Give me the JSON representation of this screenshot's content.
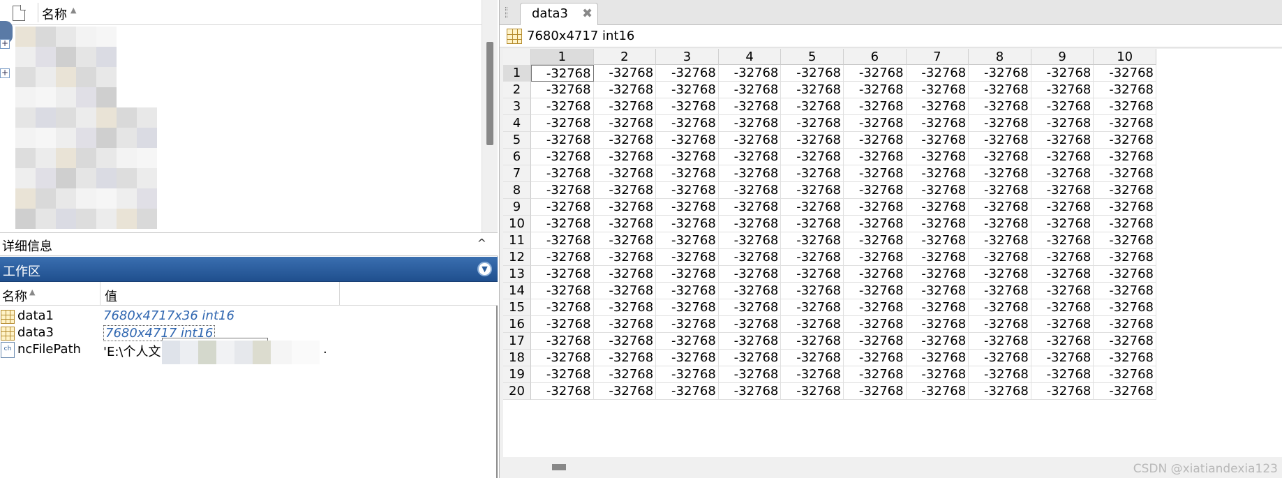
{
  "file_browser": {
    "name_header": "名称",
    "sort_icon": "sort-ascending-icon",
    "doc_icon": "document-icon"
  },
  "details": {
    "label": "详细信息",
    "caret": "^"
  },
  "workspace": {
    "title": "工作区",
    "menu_icon": "chevron-down-circle-icon",
    "menu_glyph": "▼",
    "col_name": "名称",
    "col_value": "值",
    "sort_glyph": "▲",
    "rows": [
      {
        "name": "data1",
        "value": "7680x4717x36 int16",
        "icon": "matrix-icon"
      },
      {
        "name": "data3",
        "value": "7680x4717 int16",
        "icon": "matrix-icon"
      },
      {
        "name": "ncFilePath",
        "value": "'E:\\个人文",
        "value_tail": ".",
        "icon": "char-array-icon",
        "icon_glyph": "ch"
      }
    ]
  },
  "variable_editor": {
    "tab_label": "data3",
    "tab_close": "✖",
    "info_text": "7680x4717 int16",
    "columns": [
      "1",
      "2",
      "3",
      "4",
      "5",
      "6",
      "7",
      "8",
      "9",
      "10"
    ],
    "rows": [
      "1",
      "2",
      "3",
      "4",
      "5",
      "6",
      "7",
      "8",
      "9",
      "10",
      "11",
      "12",
      "13",
      "14",
      "15",
      "16",
      "17",
      "18",
      "19",
      "20"
    ],
    "cell_value": "-32768"
  },
  "watermark": "CSDN @xiatiandexia123",
  "colors": {
    "workspace_title_bg": "#2a5d9c",
    "link_value": "#2f66b0"
  }
}
